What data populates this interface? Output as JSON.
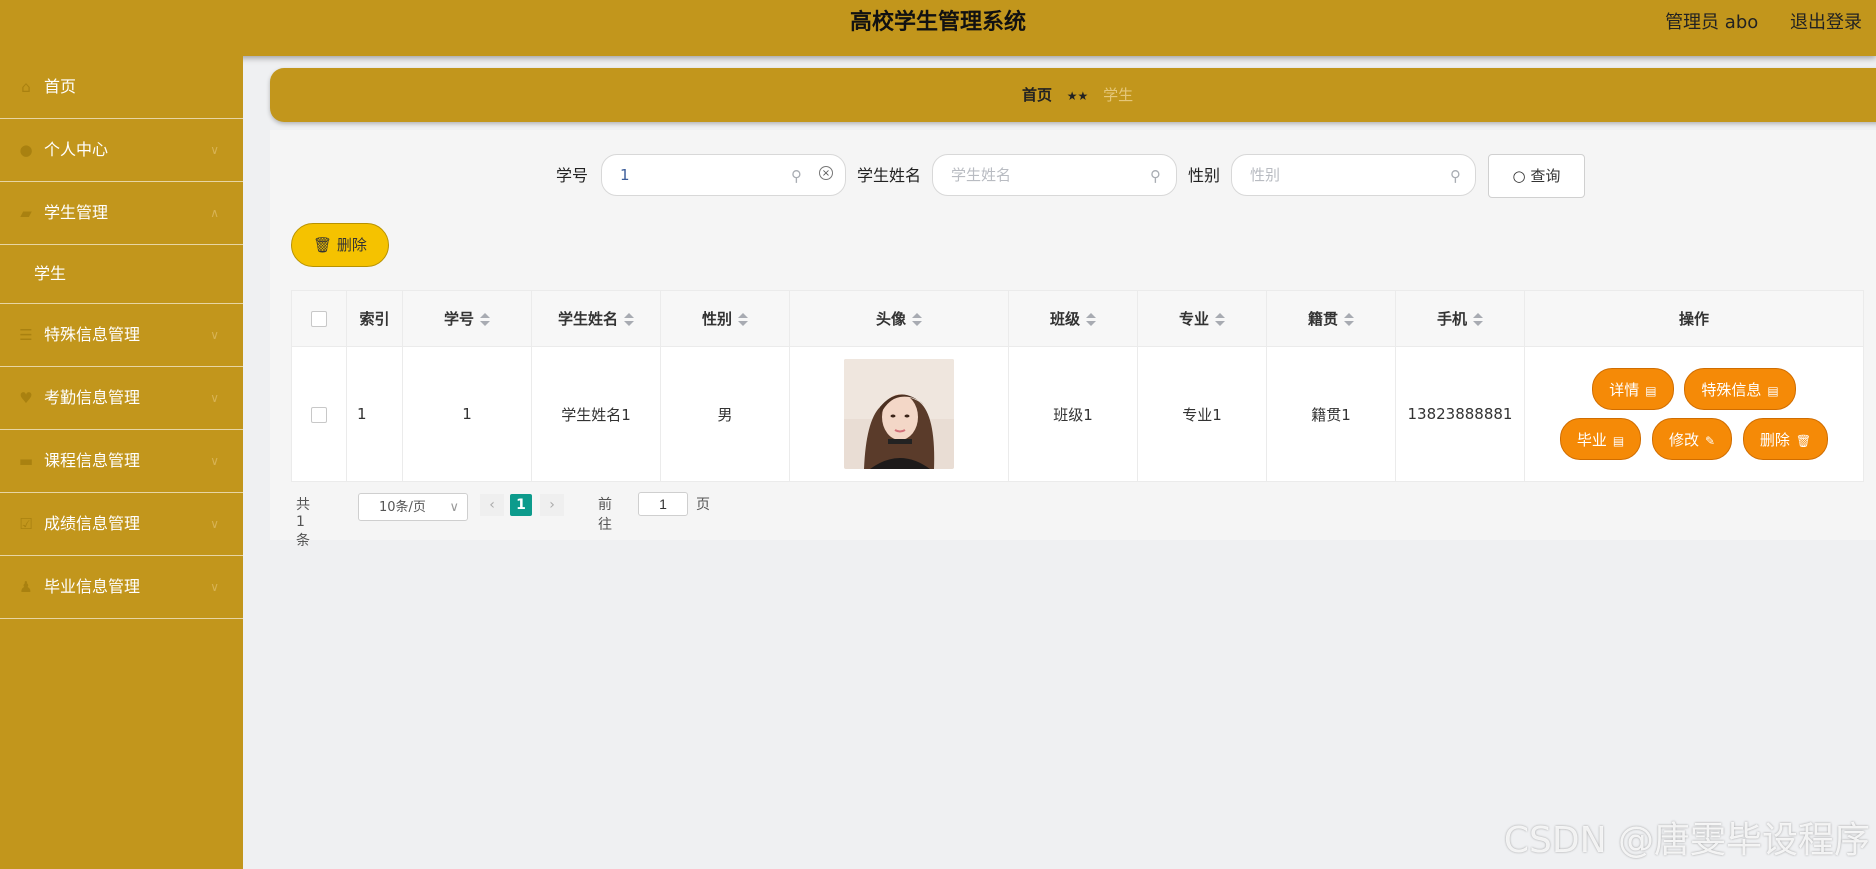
{
  "header": {
    "title": "高校学生管理系统",
    "admin_label": "管理员 abo",
    "logout_label": "退出登录"
  },
  "sidebar": {
    "items": [
      {
        "label": "首页",
        "icon": "home-icon"
      },
      {
        "label": "个人中心",
        "icon": "user-icon"
      },
      {
        "label": "学生管理",
        "icon": "briefcase-icon"
      },
      {
        "label": "学生",
        "sub": true
      },
      {
        "label": "特殊信息管理",
        "icon": "list-icon"
      },
      {
        "label": "考勤信息管理",
        "icon": "trophy-icon"
      },
      {
        "label": "课程信息管理",
        "icon": "monitor-icon"
      },
      {
        "label": "成绩信息管理",
        "icon": "checkbox-icon"
      },
      {
        "label": "毕业信息管理",
        "icon": "person-icon"
      }
    ]
  },
  "breadcrumb": {
    "home": "首页",
    "separator": "★★",
    "current": "学生"
  },
  "search": {
    "student_id_label": "学号",
    "student_id_value": "1",
    "student_name_label": "学生姓名",
    "student_name_placeholder": "学生姓名",
    "gender_label": "性别",
    "gender_placeholder": "性别",
    "query_label": "查询"
  },
  "actions": {
    "delete_label": "删除"
  },
  "table": {
    "columns": [
      "索引",
      "学号",
      "学生姓名",
      "性别",
      "头像",
      "班级",
      "专业",
      "籍贯",
      "手机",
      "操作"
    ],
    "rows": [
      {
        "index": "1",
        "student_id": "1",
        "name": "学生姓名1",
        "gender": "男",
        "class": "班级1",
        "major": "专业1",
        "hometown": "籍贯1",
        "phone": "13823888881"
      }
    ],
    "row_actions": {
      "detail": "详情",
      "special": "特殊信息",
      "graduate": "毕业",
      "edit": "修改",
      "delete": "删除"
    }
  },
  "pagination": {
    "total_label": "共 1 条",
    "page_size": "10条/页",
    "current_page": "1",
    "goto_label": "前往",
    "goto_value": "1",
    "page_unit": "页"
  },
  "watermark": "CSDN @唐雯毕设程序",
  "colors": {
    "theme": "#c2961c",
    "orange_button": "#f58a07",
    "yellow_button": "#f5c200",
    "page_active": "#0d9b8c"
  }
}
